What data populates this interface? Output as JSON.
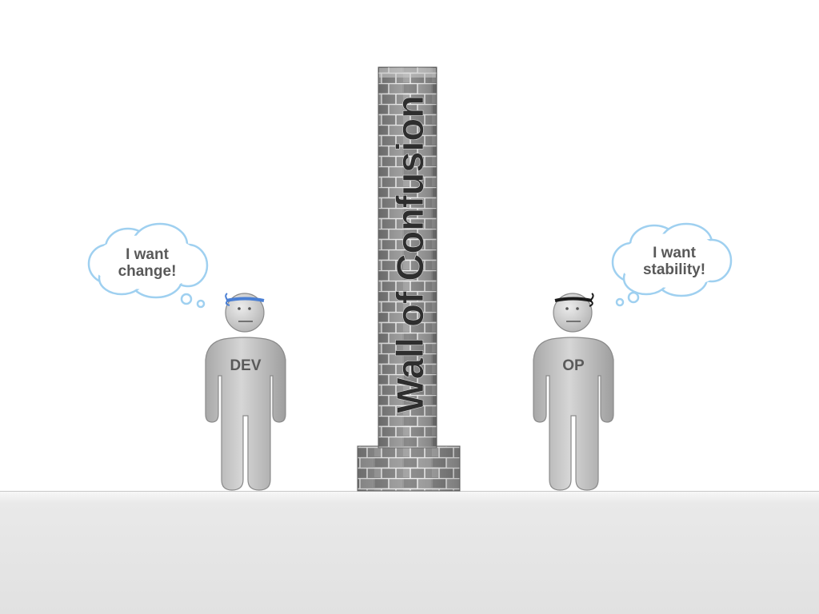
{
  "wall": {
    "label": "Wall of Confusion"
  },
  "dev": {
    "label": "DEV",
    "thought": [
      "I want",
      "change!"
    ],
    "headband_color": "#4a7fd4"
  },
  "op": {
    "label": "OP",
    "thought": [
      "I want",
      "stability!"
    ],
    "headband_color": "#1a1a1a"
  },
  "colors": {
    "cloud_stroke": "#9fd0f0",
    "figure_fill": "#c8c8c8",
    "brick_fill": "#8c8c8c",
    "floor": "#e6e6e6"
  }
}
